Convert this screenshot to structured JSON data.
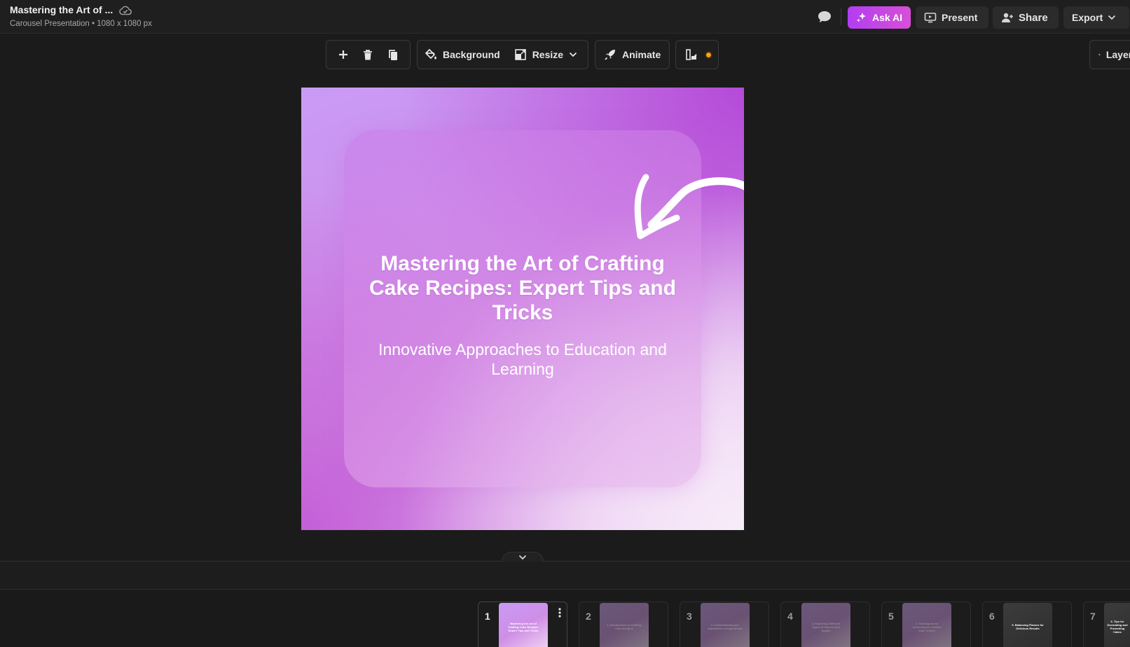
{
  "header": {
    "title": "Mastering the Art of ...",
    "subtitle": "Carousel Presentation • 1080 x 1080 px",
    "ask_ai": "Ask AI",
    "present": "Present",
    "share": "Share",
    "export": "Export",
    "accent_color": "#c447e6"
  },
  "toolbar": {
    "background": "Background",
    "resize": "Resize",
    "animate": "Animate",
    "layers": "Layers"
  },
  "slide": {
    "title": "Mastering the Art of Crafting Cake Recipes: Expert Tips and Tricks",
    "subtitle": "Innovative Approaches to Education and Learning"
  },
  "thumbnails": [
    {
      "number": "1",
      "text": "Mastering the Art of Crafting Cake Recipes: Expert Tips and Tricks",
      "active": true
    },
    {
      "number": "2",
      "text": "1. Introduction to Crafting Cake Recipes",
      "active": false
    },
    {
      "number": "3",
      "text": "2. Understanding the Importance of Ingredients",
      "active": false
    },
    {
      "number": "4",
      "text": "3. Exploring Different Types of Flavors and Sugars",
      "active": false
    },
    {
      "number": "5",
      "text": "4. Techniques for Achieving the Perfect Cake Texture",
      "active": false
    },
    {
      "number": "6",
      "text": "5. Balancing Flavors for Delicious Results",
      "active": false
    },
    {
      "number": "7",
      "text": "6. Tips for Decorating and Presenting Cakes",
      "active": false
    }
  ]
}
